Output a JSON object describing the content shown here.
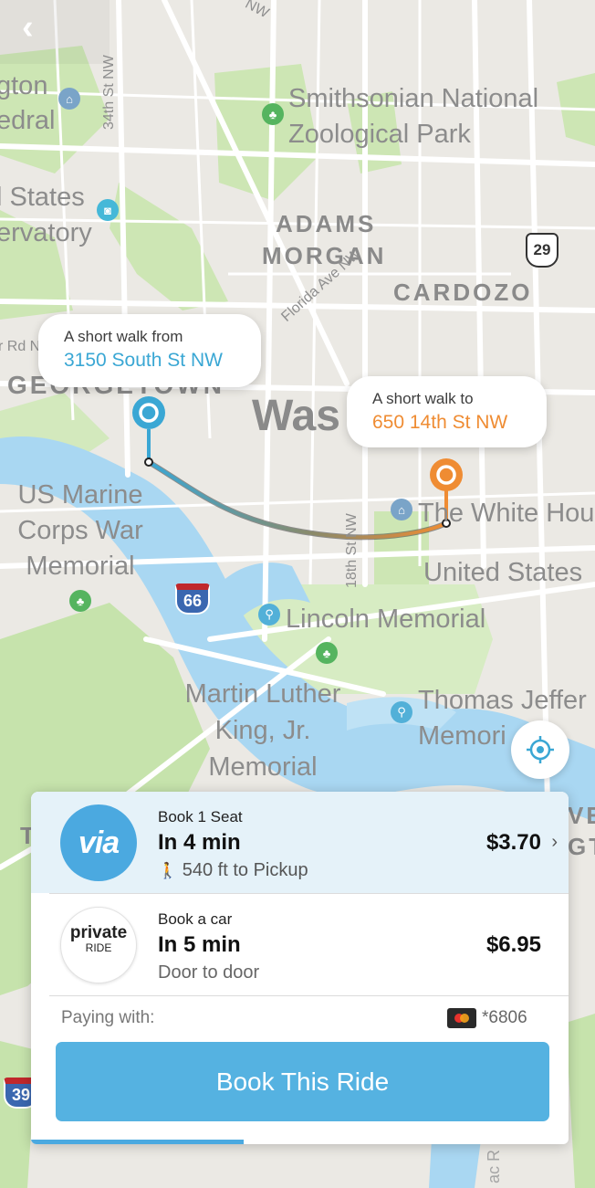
{
  "nav": {
    "back_icon": "chevron-left-icon",
    "back_glyph": "‹"
  },
  "map": {
    "labels": {
      "zoo_1": "Smithsonian National",
      "zoo_2": "Zoological Park",
      "adams": "ADAMS",
      "morgan": "MORGAN",
      "cardozo": "CARDOZO",
      "georgetown": "GEORGETOWN",
      "wash": "Was",
      "usmc_1": "US Marine",
      "usmc_2": "Corps War",
      "usmc_3": "Memorial",
      "lincoln": "Lincoln Memorial",
      "mlk_1": "Martin Luther",
      "mlk_2": "King, Jr.",
      "mlk_3": "Memorial",
      "jeff_1": "Thomas Jeffer",
      "jeff_2": "Memori",
      "white_house": "The White Hou",
      "united_states": "United States",
      "cathedral_1": "gton",
      "cathedral_2": "edral",
      "observatory_1": "l States",
      "observatory_2": "ervatory",
      "rd": "r Rd N",
      "ac": "ac R",
      "ve": "VE",
      "gt": "GT",
      "t_left": "T",
      "st_34": "34th St NW",
      "st_18": "18th St NW",
      "florida": "Florida Ave NW",
      "top_street": "NW"
    },
    "shields": {
      "i66": "66",
      "us29": "29",
      "i395": "39"
    },
    "pickup_bubble": {
      "caption": "A short walk from",
      "address": "3150 South St NW"
    },
    "dropoff_bubble": {
      "caption": "A short walk to",
      "address": "650 14th St NW"
    },
    "recenter_icon": "crosshair-icon"
  },
  "colors": {
    "via_blue": "#4ba9e0",
    "pickup": "#3aa7d4",
    "dropoff": "#ef8c33",
    "button": "#55b2e1"
  },
  "options": [
    {
      "logo": "via",
      "title": "Book 1 Seat",
      "eta": "In 4 min",
      "sub": "540 ft to Pickup",
      "price": "$3.70",
      "walk_icon": "walking-person-icon"
    },
    {
      "logo_1": "private",
      "logo_2": "RIDE",
      "title": "Book a car",
      "eta": "In 5 min",
      "sub": "Door to door",
      "price": "$6.95"
    }
  ],
  "payment": {
    "label": "Paying with:",
    "card": "*6806",
    "card_icon": "mastercard-icon"
  },
  "book_button": "Book This Ride"
}
